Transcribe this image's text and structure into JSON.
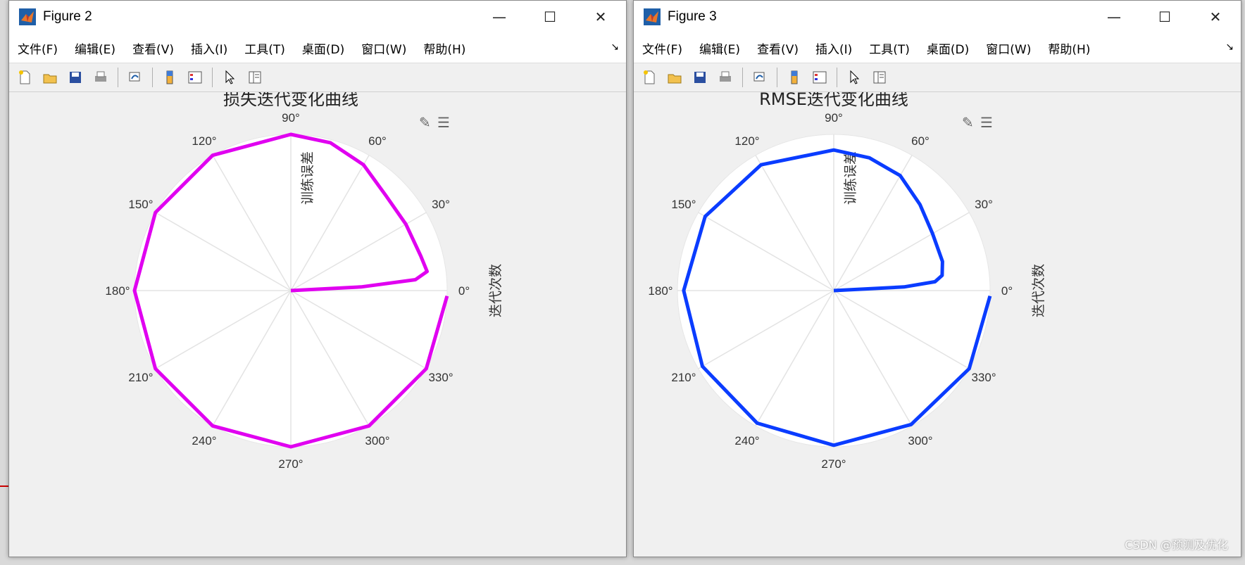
{
  "windows": [
    {
      "title": "Figure 2",
      "menu": [
        "文件(F)",
        "编辑(E)",
        "查看(V)",
        "插入(I)",
        "工具(T)",
        "桌面(D)",
        "窗口(W)",
        "帮助(H)"
      ],
      "chart_title": "损失迭代变化曲线",
      "radial_label": "训练误差",
      "angular_label": "迭代次数",
      "color": "#e000f0"
    },
    {
      "title": "Figure 3",
      "menu": [
        "文件(F)",
        "编辑(E)",
        "查看(V)",
        "插入(I)",
        "工具(T)",
        "桌面(D)",
        "窗口(W)",
        "帮助(H)"
      ],
      "chart_title": "RMSE迭代变化曲线",
      "radial_label": "训练误差",
      "angular_label": "迭代次数",
      "color": "#0a3cff"
    }
  ],
  "chart_data": [
    {
      "type": "line",
      "title": "损失迭代变化曲线",
      "radial_label": "训练误差",
      "angular_label": "迭代次数",
      "theta_ticks": [
        "0°",
        "30°",
        "60°",
        "90°",
        "120°",
        "150°",
        "180°",
        "210°",
        "240°",
        "270°",
        "300°",
        "330°"
      ],
      "series": [
        {
          "color": "#e000f0",
          "points": [
            [
              0,
              0
            ],
            [
              3,
              0.45
            ],
            [
              5,
              0.8
            ],
            [
              8,
              0.88
            ],
            [
              15,
              0.86
            ],
            [
              30,
              0.85
            ],
            [
              45,
              0.86
            ],
            [
              60,
              0.93
            ],
            [
              75,
              0.98
            ],
            [
              90,
              1.0
            ],
            [
              120,
              1.0
            ],
            [
              150,
              1.0
            ],
            [
              180,
              1.0
            ],
            [
              210,
              1.0
            ],
            [
              240,
              1.0
            ],
            [
              270,
              1.0
            ],
            [
              300,
              1.0
            ],
            [
              330,
              1.0
            ],
            [
              358,
              1.0
            ]
          ]
        }
      ]
    },
    {
      "type": "line",
      "title": "RMSE迭代变化曲线",
      "radial_label": "训练误差",
      "angular_label": "迭代次数",
      "theta_ticks": [
        "0°",
        "30°",
        "60°",
        "90°",
        "120°",
        "150°",
        "180°",
        "210°",
        "240°",
        "270°",
        "300°",
        "330°"
      ],
      "series": [
        {
          "color": "#0a3cff",
          "points": [
            [
              0,
              0
            ],
            [
              3,
              0.45
            ],
            [
              5,
              0.65
            ],
            [
              8,
              0.7
            ],
            [
              15,
              0.72
            ],
            [
              30,
              0.73
            ],
            [
              45,
              0.78
            ],
            [
              60,
              0.85
            ],
            [
              75,
              0.88
            ],
            [
              90,
              0.9
            ],
            [
              120,
              0.93
            ],
            [
              150,
              0.95
            ],
            [
              180,
              0.96
            ],
            [
              210,
              0.97
            ],
            [
              240,
              0.98
            ],
            [
              270,
              0.99
            ],
            [
              300,
              0.99
            ],
            [
              330,
              1.0
            ],
            [
              358,
              1.0
            ]
          ]
        }
      ]
    }
  ],
  "watermark": "CSDN @预测及优化"
}
